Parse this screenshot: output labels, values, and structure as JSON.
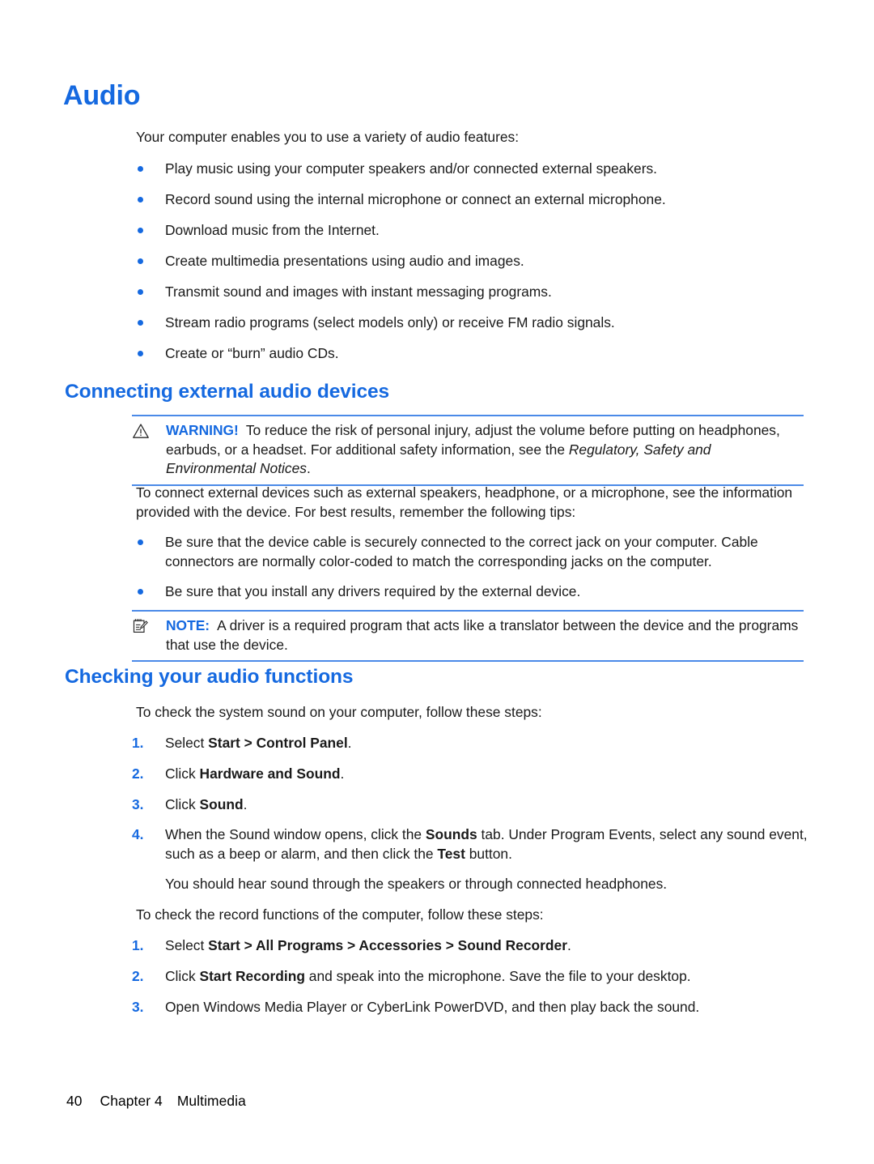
{
  "theme": {
    "accent_blue": "#1569e0",
    "rule_blue": "#4b8ae8",
    "text_black": "#1a1a1a"
  },
  "page": {
    "title": "Audio",
    "intro": "Your computer enables you to use a variety of audio features:"
  },
  "audio_features": [
    "Play music using your computer speakers and/or connected external speakers.",
    "Record sound using the internal microphone or connect an external microphone.",
    "Download music from the Internet.",
    "Create multimedia presentations using audio and images.",
    "Transmit sound and images with instant messaging programs.",
    "Stream radio programs (select models only) or receive FM radio signals.",
    "Create or “burn” audio CDs."
  ],
  "connecting": {
    "heading": "Connecting external audio devices",
    "warning": {
      "label": "WARNING!",
      "icon": "warning-triangle-icon",
      "text_part1": "To reduce the risk of personal injury, adjust the volume before putting on headphones, earbuds, or a headset. For additional safety information, see the ",
      "text_italic": "Regulatory, Safety and Environmental Notices",
      "text_part2": "."
    },
    "paragraph": "To connect external devices such as external speakers, headphone, or a microphone, see the information provided with the device. For best results, remember the following tips:",
    "tips": [
      "Be sure that the device cable is securely connected to the correct jack on your computer. Cable connectors are normally color-coded to match the corresponding jacks on the computer.",
      "Be sure that you install any drivers required by the external device."
    ],
    "note": {
      "label": "NOTE:",
      "icon": "note-pad-icon",
      "text": "A driver is a required program that acts like a translator between the device and the programs that use the device."
    }
  },
  "checking": {
    "heading": "Checking your audio functions",
    "system_sound_intro": "To check the system sound on your computer, follow these steps:",
    "system_sound_steps": [
      {
        "number": "1.",
        "parts": [
          {
            "text": "Select ",
            "bold": false
          },
          {
            "text": "Start > Control Panel",
            "bold": true
          },
          {
            "text": ".",
            "bold": false
          }
        ]
      },
      {
        "number": "2.",
        "parts": [
          {
            "text": "Click ",
            "bold": false
          },
          {
            "text": "Hardware and Sound",
            "bold": true
          },
          {
            "text": ".",
            "bold": false
          }
        ]
      },
      {
        "number": "3.",
        "parts": [
          {
            "text": "Click ",
            "bold": false
          },
          {
            "text": "Sound",
            "bold": true
          },
          {
            "text": ".",
            "bold": false
          }
        ]
      },
      {
        "number": "4.",
        "parts": [
          {
            "text": "When the Sound window opens, click the ",
            "bold": false
          },
          {
            "text": "Sounds",
            "bold": true
          },
          {
            "text": " tab. Under Program Events, select any sound event, such as a beep or alarm, and then click the ",
            "bold": false
          },
          {
            "text": "Test",
            "bold": true
          },
          {
            "text": " button.",
            "bold": false
          }
        ]
      }
    ],
    "result_text": "You should hear sound through the speakers or through connected headphones.",
    "record_intro": "To check the record functions of the computer, follow these steps:",
    "record_steps": [
      {
        "number": "1.",
        "parts": [
          {
            "text": "Select ",
            "bold": false
          },
          {
            "text": "Start > All Programs > Accessories > Sound Recorder",
            "bold": true
          },
          {
            "text": ".",
            "bold": false
          }
        ]
      },
      {
        "number": "2.",
        "parts": [
          {
            "text": "Click ",
            "bold": false
          },
          {
            "text": "Start Recording",
            "bold": true
          },
          {
            "text": " and speak into the microphone. Save the file to your desktop.",
            "bold": false
          }
        ]
      },
      {
        "number": "3.",
        "parts": [
          {
            "text": "Open Windows Media Player or CyberLink PowerDVD, and then play back the sound.",
            "bold": false
          }
        ]
      }
    ]
  },
  "footer": {
    "page_number": "40",
    "chapter": "Chapter 4",
    "chapter_title": "Multimedia"
  }
}
